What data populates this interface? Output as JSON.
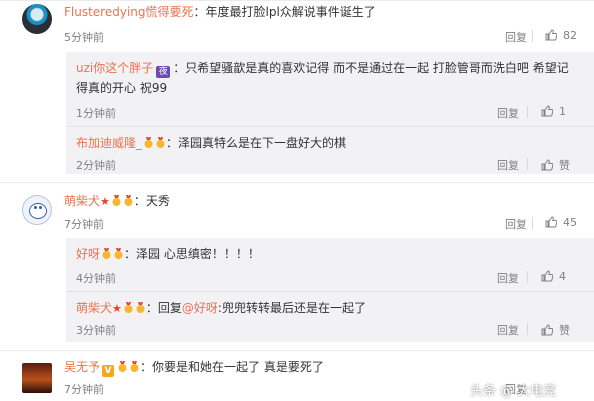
{
  "comments": [
    {
      "user": "Flusteredying慌得要死",
      "text": "：年度最打脸lpl众解说事件诞生了",
      "time": "5分钟前",
      "reply_label": "回复",
      "likes": "82"
    },
    {
      "user": "uzi你这个胖子",
      "text": "：只希望骚歆是真的喜欢记得 而不是通过在一起 打脸管哥而洗白吧 希望记",
      "text_line2": "得真的开心 祝99",
      "badge_text": "夜",
      "time": "1分钟前",
      "reply_label": "回复",
      "likes": "1"
    },
    {
      "user": "布加迪威隆_",
      "text": "：泽园真特么是在下一盘好大的棋",
      "time": "2分钟前",
      "reply_label": "回复",
      "likes": "赞"
    },
    {
      "user": "萌柴犬",
      "text": "：天秀",
      "time": "7分钟前",
      "reply_label": "回复",
      "likes": "45"
    },
    {
      "user": "好呀",
      "text": "：泽园 心思缜密！！！！",
      "time": "4分钟前",
      "reply_label": "回复",
      "likes": "4"
    },
    {
      "user": "萌柴犬",
      "text_prefix": "：回复",
      "mention": "@好呀",
      "text": ":兜兜转转最后还是在一起了",
      "time": "3分钟前",
      "reply_label": "回复",
      "likes": "赞"
    },
    {
      "user": "吴无予",
      "vip_text": "V",
      "text": "：你要是和她在一起了 真是要死了",
      "time": "7分钟前",
      "reply_label": "回复",
      "likes": ""
    }
  ],
  "watermark": "头条 @ 大电竞",
  "colors": {
    "username": "#eb7350",
    "subbox_bg": "#f2f2f5",
    "meta": "#808080"
  }
}
